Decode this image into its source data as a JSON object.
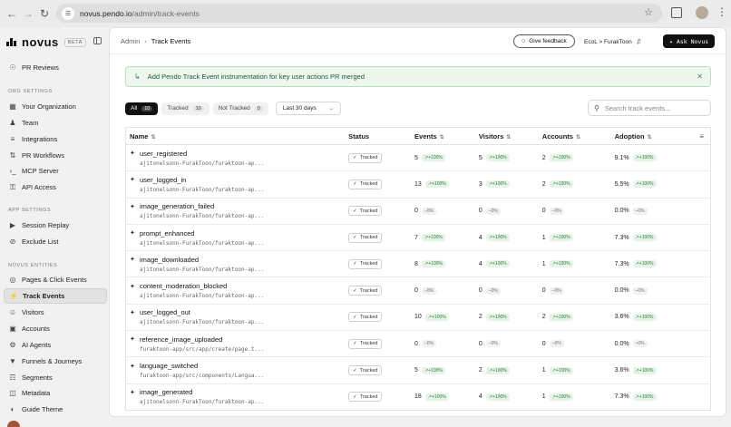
{
  "browser": {
    "url_host": "novus.pendo.io",
    "url_path": "/admin/track-events"
  },
  "brand": {
    "logo": "novus",
    "badge": "BETA"
  },
  "sidebar": {
    "top_items": [
      {
        "label": "PR Reviews",
        "icon": "eye-icon"
      }
    ],
    "org_settings_title": "ORG SETTINGS",
    "org_items": [
      {
        "label": "Your Organization",
        "icon": "building-icon"
      },
      {
        "label": "Team",
        "icon": "team-icon"
      },
      {
        "label": "Integrations",
        "icon": "sliders-icon"
      },
      {
        "label": "PR Workflows",
        "icon": "workflow-icon"
      },
      {
        "label": "MCP Server",
        "icon": "terminal-icon"
      },
      {
        "label": "API Access",
        "icon": "key-icon"
      }
    ],
    "app_settings_title": "APP SETTINGS",
    "app_items": [
      {
        "label": "Session Replay",
        "icon": "replay-icon"
      },
      {
        "label": "Exclude List",
        "icon": "block-icon"
      }
    ],
    "entities_title": "NOVUS ENTITIES",
    "entity_items": [
      {
        "label": "Pages & Click Events",
        "icon": "globe-icon"
      },
      {
        "label": "Track Events",
        "icon": "zap-icon",
        "active": true
      },
      {
        "label": "Visitors",
        "icon": "user-icon"
      },
      {
        "label": "Accounts",
        "icon": "accounts-icon"
      },
      {
        "label": "AI Agents",
        "icon": "bot-icon"
      },
      {
        "label": "Funnels & Journeys",
        "icon": "funnel-icon"
      },
      {
        "label": "Segments",
        "icon": "segments-icon"
      },
      {
        "label": "Metadata",
        "icon": "database-icon"
      },
      {
        "label": "Guide Theme",
        "icon": "palette-icon"
      }
    ]
  },
  "header": {
    "breadcrumb_root": "Admin",
    "breadcrumb_current": "Track Events",
    "feedback_label": "Give feedback",
    "org_switch": "EcoL > FurakToon",
    "ask_label": "Ask Novus"
  },
  "banner": {
    "text": "Add Pendo Track Event instrumentation for key user actions PR merged"
  },
  "filters": {
    "all_label": "All",
    "all_count": "10",
    "tracked_label": "Tracked",
    "tracked_count": "10",
    "not_tracked_label": "Not Tracked",
    "not_tracked_count": "0",
    "range": "Last 30 days"
  },
  "search": {
    "placeholder": "Search track events..."
  },
  "table": {
    "headers": {
      "name": "Name",
      "status": "Status",
      "events": "Events",
      "visitors": "Visitors",
      "accounts": "Accounts",
      "adoption": "Adoption"
    },
    "rows": [
      {
        "name": "user_registered",
        "path": "ajitonelsonn-FurakToon/furaktoon-ap...",
        "status": "Tracked",
        "events": "5",
        "events_chg": "+100%",
        "visitors": "5",
        "visitors_chg": "+100%",
        "accounts": "2",
        "accounts_chg": "+100%",
        "adoption": "9.1%",
        "adoption_chg": "+100%"
      },
      {
        "name": "user_logged_in",
        "path": "ajitonelsonn-FurakToon/furaktoon-ap...",
        "status": "Tracked",
        "events": "13",
        "events_chg": "+100%",
        "visitors": "3",
        "visitors_chg": "+100%",
        "accounts": "2",
        "accounts_chg": "+100%",
        "adoption": "5.5%",
        "adoption_chg": "+100%"
      },
      {
        "name": "image_generation_failed",
        "path": "ajitonelsonn-FurakToon/furaktoon-ap...",
        "status": "Tracked",
        "events": "0",
        "events_chg": "0%",
        "visitors": "0",
        "visitors_chg": "0%",
        "accounts": "0",
        "accounts_chg": "0%",
        "adoption": "0.0%",
        "adoption_chg": "0%"
      },
      {
        "name": "prompt_enhanced",
        "path": "ajitonelsonn-FurakToon/furaktoon-ap...",
        "status": "Tracked",
        "events": "7",
        "events_chg": "+100%",
        "visitors": "4",
        "visitors_chg": "+100%",
        "accounts": "1",
        "accounts_chg": "+100%",
        "adoption": "7.3%",
        "adoption_chg": "+100%"
      },
      {
        "name": "image_downloaded",
        "path": "ajitonelsonn-FurakToon/furaktoon-ap...",
        "status": "Tracked",
        "events": "8",
        "events_chg": "+100%",
        "visitors": "4",
        "visitors_chg": "+100%",
        "accounts": "1",
        "accounts_chg": "+100%",
        "adoption": "7.3%",
        "adoption_chg": "+100%"
      },
      {
        "name": "content_moderation_blocked",
        "path": "ajitonelsonn-FurakToon/furaktoon-ap...",
        "status": "Tracked",
        "events": "0",
        "events_chg": "0%",
        "visitors": "0",
        "visitors_chg": "0%",
        "accounts": "0",
        "accounts_chg": "0%",
        "adoption": "0.0%",
        "adoption_chg": "0%"
      },
      {
        "name": "user_logged_out",
        "path": "ajitonelsonn-FurakToon/furaktoon-ap...",
        "status": "Tracked",
        "events": "10",
        "events_chg": "+100%",
        "visitors": "2",
        "visitors_chg": "+100%",
        "accounts": "2",
        "accounts_chg": "+100%",
        "adoption": "3.6%",
        "adoption_chg": "+100%"
      },
      {
        "name": "reference_image_uploaded",
        "path": "furaktoon-app/src/app/create/page.t...",
        "status": "Tracked",
        "events": "0",
        "events_chg": "0%",
        "visitors": "0",
        "visitors_chg": "0%",
        "accounts": "0",
        "accounts_chg": "0%",
        "adoption": "0.0%",
        "adoption_chg": "0%"
      },
      {
        "name": "language_switched",
        "path": "furaktoon-app/src/components/Langua...",
        "status": "Tracked",
        "events": "5",
        "events_chg": "+100%",
        "visitors": "2",
        "visitors_chg": "+100%",
        "accounts": "1",
        "accounts_chg": "+100%",
        "adoption": "3.6%",
        "adoption_chg": "+100%"
      },
      {
        "name": "image_generated",
        "path": "ajitonelsonn-FurakToon/furaktoon-ap...",
        "status": "Tracked",
        "events": "18",
        "events_chg": "+100%",
        "visitors": "4",
        "visitors_chg": "+100%",
        "accounts": "1",
        "accounts_chg": "+100%",
        "adoption": "7.3%",
        "adoption_chg": "+100%"
      }
    ]
  },
  "colors": {
    "accent_green": "#2e7d3a",
    "banner_bg": "#eef7ee",
    "active_nav": "#e2e2e2"
  }
}
